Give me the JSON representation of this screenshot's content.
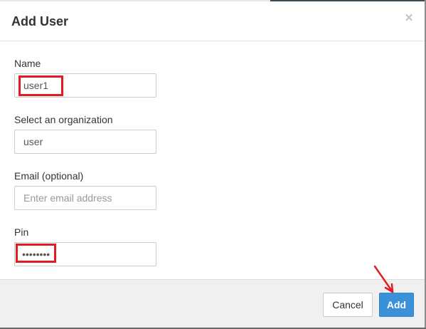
{
  "dialog": {
    "title": "Add User",
    "close_glyph": "×",
    "close_icon": "close-icon"
  },
  "form": {
    "name": {
      "label": "Name",
      "value": "user1"
    },
    "organization": {
      "label": "Select an organization",
      "value": "user"
    },
    "email": {
      "label": "Email (optional)",
      "value": "",
      "placeholder": "Enter email address"
    },
    "pin": {
      "label": "Pin",
      "value": "••••••••"
    }
  },
  "footer": {
    "cancel_label": "Cancel",
    "add_label": "Add"
  },
  "annotations": {
    "highlight_color": "#e31b23",
    "arrow_color": "#e31b23"
  },
  "colors": {
    "primary_button": "#3a91d8",
    "footer_background": "#f0f0f0",
    "input_border": "#cccccc"
  }
}
